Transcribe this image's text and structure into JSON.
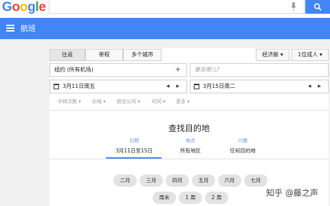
{
  "google": {
    "logo_letters": [
      "G",
      "o",
      "o",
      "g",
      "l",
      "e"
    ],
    "logo_colors": [
      "#4285f4",
      "#ea4335",
      "#fbbc05",
      "#4285f4",
      "#34a853",
      "#ea4335"
    ],
    "search_value": "",
    "search_icon": "search-icon",
    "mic_icon": "mic-icon",
    "accent": "#4285f4"
  },
  "appbar": {
    "title": "航班",
    "menu_icon": "menu-icon"
  },
  "trip_tabs": [
    {
      "label": "往返",
      "active": true
    },
    {
      "label": "单程",
      "active": false
    },
    {
      "label": "多个城市",
      "active": false
    }
  ],
  "cabin_select": "经济舱 ▾",
  "passengers_select": "1位成人 ▾",
  "origin": {
    "value": "纽约 (所有机场)",
    "add_symbol": "+"
  },
  "destination": {
    "placeholder": "要去哪儿?"
  },
  "depart_date": {
    "value": "3月11日周五",
    "arrows": "◀ ▶"
  },
  "return_date": {
    "value": "3月15日周二",
    "arrows": "◀ ▶"
  },
  "filters": [
    "中转次数 ▾",
    "价格 ▾",
    "航空公司 ▾",
    "时间 ▾",
    "更多 ▾"
  ],
  "explore": {
    "title": "查找目的地",
    "columns": [
      {
        "label": "日期",
        "value": "3月11日至15日"
      },
      {
        "label": "地点",
        "value": "所有地区"
      },
      {
        "label": "兴趣",
        "value": "任何目的地"
      }
    ],
    "months": [
      "二月",
      "三月",
      "四月",
      "五月",
      "六月",
      "七月"
    ],
    "durations": [
      "周末",
      "1 周",
      "2 周"
    ]
  },
  "watermark": "知乎 @藤之声"
}
